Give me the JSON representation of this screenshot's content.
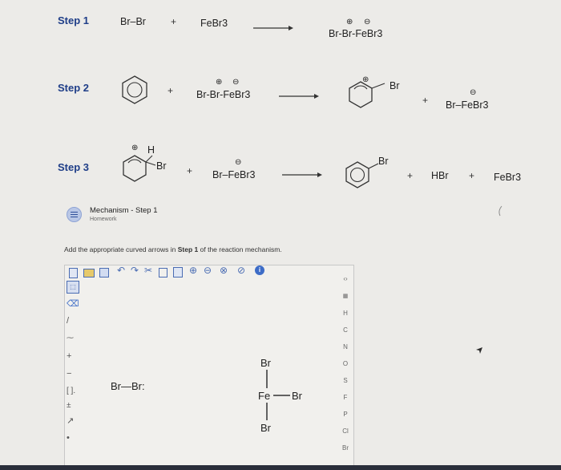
{
  "step1": {
    "label": "Step 1",
    "reactant1": "Br–Br",
    "plus": "+",
    "reactant2": "FeBr3",
    "product": "Br-Br-FeBr3",
    "plus_charge": "⊕",
    "minus_charge": "⊖"
  },
  "step2": {
    "label": "Step 2",
    "plus1": "+",
    "reactant2": "Br-Br-FeBr3",
    "plus_charge": "⊕",
    "minus_charge": "⊖",
    "product_br": "Br",
    "product_charge": "⊕",
    "plus2": "+",
    "product2": "Br–FeBr3",
    "product2_charge": "⊖"
  },
  "step3": {
    "label": "Step 3",
    "reactant1_h": "H",
    "reactant1_br": "Br",
    "reactant1_charge": "⊕",
    "plus1": "+",
    "reactant2": "Br–FeBr3",
    "reactant2_charge": "⊖",
    "product_br": "Br",
    "plus2": "+",
    "product2": "HBr",
    "plus3": "+",
    "product3": "FeBr3"
  },
  "assignment": {
    "title": "Mechanism - Step 1",
    "subtitle": "Homework",
    "instruction_prefix": "Add the appropriate curved arrows in ",
    "instruction_bold": "Step 1",
    "instruction_suffix": " of the reaction mechanism."
  },
  "editor": {
    "atoms": [
      "H",
      "C",
      "N",
      "O",
      "S",
      "F",
      "P",
      "Cl",
      "Br"
    ],
    "molecule1": "Br—Br:",
    "mol2_top": "Br",
    "mol2_center": "Fe",
    "mol2_right": "Br",
    "mol2_bottom": "Br"
  },
  "colors": {
    "step_label": "#1f3e88",
    "background": "#ecebe8",
    "accent": "#3d6cc7"
  }
}
